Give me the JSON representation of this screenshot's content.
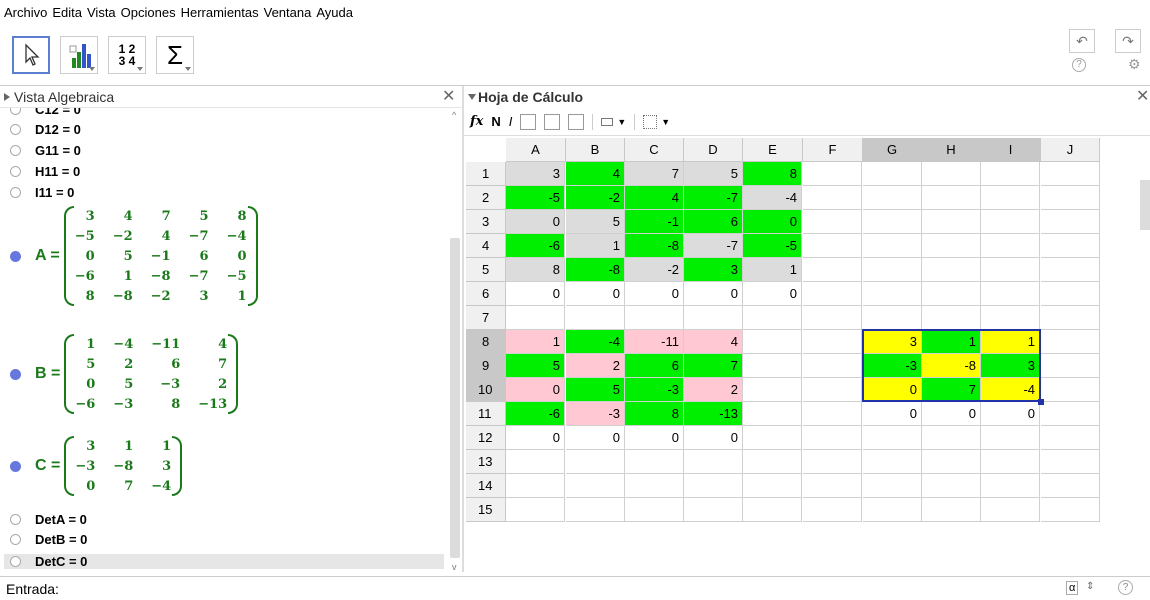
{
  "menu": [
    "Archivo",
    "Edita",
    "Vista",
    "Opciones",
    "Herramientas",
    "Ventana",
    "Ayuda"
  ],
  "toolbar": {
    "tools": [
      "move-tool",
      "chart-tool",
      "table-tool",
      "sum-tool"
    ],
    "table_tool_glyph": "1 2\n3 4",
    "sum_glyph": "Σ",
    "undo_glyph": "↶",
    "redo_glyph": "↷",
    "help_glyph": "?",
    "settings_glyph": "⚙"
  },
  "algebra_view": {
    "title": "Vista Algebraica",
    "items_top": [
      {
        "label": "C12 = 0",
        "filled": false
      },
      {
        "label": "D12 = 0",
        "filled": false
      },
      {
        "label": "G11 = 0",
        "filled": false
      },
      {
        "label": "H11 = 0",
        "filled": false
      },
      {
        "label": "I11 = 0",
        "filled": false
      }
    ],
    "matrices": [
      {
        "name": "A =",
        "rows": [
          [
            "3",
            "4",
            "7",
            "5",
            "8"
          ],
          [
            "−5",
            "−2",
            "4",
            "−7",
            "−4"
          ],
          [
            "0",
            "5",
            "−1",
            "6",
            "0"
          ],
          [
            "−6",
            "1",
            "−8",
            "−7",
            "−5"
          ],
          [
            "8",
            "−8",
            "−2",
            "3",
            "1"
          ]
        ]
      },
      {
        "name": "B =",
        "rows": [
          [
            "1",
            "−4",
            "−11",
            "4"
          ],
          [
            "5",
            "2",
            "6",
            "7"
          ],
          [
            "0",
            "5",
            "−3",
            "2"
          ],
          [
            "−6",
            "−3",
            "8",
            "−13"
          ]
        ]
      },
      {
        "name": "C =",
        "rows": [
          [
            "3",
            "1",
            "1"
          ],
          [
            "−3",
            "−8",
            "3"
          ],
          [
            "0",
            "7",
            "−4"
          ]
        ]
      }
    ],
    "items_bottom": [
      {
        "label": "DetA = 0",
        "filled": false
      },
      {
        "label": "DetB = 0",
        "filled": false
      },
      {
        "label": "DetC = 0",
        "filled": false
      }
    ]
  },
  "spreadsheet": {
    "title": "Hoja de Cálculo",
    "format_bar": {
      "fx": "fx",
      "bold": "N",
      "italic": "I"
    },
    "columns": [
      "A",
      "B",
      "C",
      "D",
      "E",
      "F",
      "G",
      "H",
      "I",
      "J"
    ],
    "highlight_cols": [
      "G",
      "H",
      "I"
    ],
    "rows": [
      "1",
      "2",
      "3",
      "4",
      "5",
      "6",
      "7",
      "8",
      "9",
      "10",
      "11",
      "12",
      "13",
      "14",
      "15"
    ],
    "highlight_rows": [
      "8",
      "9",
      "10"
    ],
    "cells": [
      {
        "r": 0,
        "c": 0,
        "v": "3",
        "bg": "#dcdcdc"
      },
      {
        "r": 0,
        "c": 1,
        "v": "4",
        "bg": "#00ee00"
      },
      {
        "r": 0,
        "c": 2,
        "v": "7",
        "bg": "#dcdcdc"
      },
      {
        "r": 0,
        "c": 3,
        "v": "5",
        "bg": "#dcdcdc"
      },
      {
        "r": 0,
        "c": 4,
        "v": "8",
        "bg": "#00ee00"
      },
      {
        "r": 1,
        "c": 0,
        "v": "-5",
        "bg": "#00ee00"
      },
      {
        "r": 1,
        "c": 1,
        "v": "-2",
        "bg": "#00ee00"
      },
      {
        "r": 1,
        "c": 2,
        "v": "4",
        "bg": "#00ee00"
      },
      {
        "r": 1,
        "c": 3,
        "v": "-7",
        "bg": "#00ee00"
      },
      {
        "r": 1,
        "c": 4,
        "v": "-4",
        "bg": "#dcdcdc"
      },
      {
        "r": 2,
        "c": 0,
        "v": "0",
        "bg": "#dcdcdc"
      },
      {
        "r": 2,
        "c": 1,
        "v": "5",
        "bg": "#dcdcdc"
      },
      {
        "r": 2,
        "c": 2,
        "v": "-1",
        "bg": "#00ee00"
      },
      {
        "r": 2,
        "c": 3,
        "v": "6",
        "bg": "#00ee00"
      },
      {
        "r": 2,
        "c": 4,
        "v": "0",
        "bg": "#00ee00"
      },
      {
        "r": 3,
        "c": 0,
        "v": "-6",
        "bg": "#00ee00"
      },
      {
        "r": 3,
        "c": 1,
        "v": "1",
        "bg": "#dcdcdc"
      },
      {
        "r": 3,
        "c": 2,
        "v": "-8",
        "bg": "#00ee00"
      },
      {
        "r": 3,
        "c": 3,
        "v": "-7",
        "bg": "#dcdcdc"
      },
      {
        "r": 3,
        "c": 4,
        "v": "-5",
        "bg": "#00ee00"
      },
      {
        "r": 4,
        "c": 0,
        "v": "8",
        "bg": "#dcdcdc"
      },
      {
        "r": 4,
        "c": 1,
        "v": "-8",
        "bg": "#00ee00"
      },
      {
        "r": 4,
        "c": 2,
        "v": "-2",
        "bg": "#dcdcdc"
      },
      {
        "r": 4,
        "c": 3,
        "v": "3",
        "bg": "#00ee00"
      },
      {
        "r": 4,
        "c": 4,
        "v": "1",
        "bg": "#dcdcdc"
      },
      {
        "r": 5,
        "c": 0,
        "v": "0",
        "bg": ""
      },
      {
        "r": 5,
        "c": 1,
        "v": "0",
        "bg": ""
      },
      {
        "r": 5,
        "c": 2,
        "v": "0",
        "bg": ""
      },
      {
        "r": 5,
        "c": 3,
        "v": "0",
        "bg": ""
      },
      {
        "r": 5,
        "c": 4,
        "v": "0",
        "bg": ""
      },
      {
        "r": 7,
        "c": 0,
        "v": "1",
        "bg": "#ffc8d2"
      },
      {
        "r": 7,
        "c": 1,
        "v": "-4",
        "bg": "#00ee00"
      },
      {
        "r": 7,
        "c": 2,
        "v": "-11",
        "bg": "#ffc8d2"
      },
      {
        "r": 7,
        "c": 3,
        "v": "4",
        "bg": "#ffc8d2"
      },
      {
        "r": 8,
        "c": 0,
        "v": "5",
        "bg": "#00ee00"
      },
      {
        "r": 8,
        "c": 1,
        "v": "2",
        "bg": "#ffc8d2"
      },
      {
        "r": 8,
        "c": 2,
        "v": "6",
        "bg": "#00ee00"
      },
      {
        "r": 8,
        "c": 3,
        "v": "7",
        "bg": "#00ee00"
      },
      {
        "r": 9,
        "c": 0,
        "v": "0",
        "bg": "#ffc8d2"
      },
      {
        "r": 9,
        "c": 1,
        "v": "5",
        "bg": "#00ee00"
      },
      {
        "r": 9,
        "c": 2,
        "v": "-3",
        "bg": "#00ee00"
      },
      {
        "r": 9,
        "c": 3,
        "v": "2",
        "bg": "#ffc8d2"
      },
      {
        "r": 10,
        "c": 0,
        "v": "-6",
        "bg": "#00ee00"
      },
      {
        "r": 10,
        "c": 1,
        "v": "-3",
        "bg": "#ffc8d2"
      },
      {
        "r": 10,
        "c": 2,
        "v": "8",
        "bg": "#00ee00"
      },
      {
        "r": 10,
        "c": 3,
        "v": "-13",
        "bg": "#00ee00"
      },
      {
        "r": 11,
        "c": 0,
        "v": "0",
        "bg": ""
      },
      {
        "r": 11,
        "c": 1,
        "v": "0",
        "bg": ""
      },
      {
        "r": 11,
        "c": 2,
        "v": "0",
        "bg": ""
      },
      {
        "r": 11,
        "c": 3,
        "v": "0",
        "bg": ""
      },
      {
        "r": 7,
        "c": 6,
        "v": "3",
        "bg": "#ffff00"
      },
      {
        "r": 7,
        "c": 7,
        "v": "1",
        "bg": "#00ee00"
      },
      {
        "r": 7,
        "c": 8,
        "v": "1",
        "bg": "#ffff00"
      },
      {
        "r": 8,
        "c": 6,
        "v": "-3",
        "bg": "#00ee00"
      },
      {
        "r": 8,
        "c": 7,
        "v": "-8",
        "bg": "#ffff00"
      },
      {
        "r": 8,
        "c": 8,
        "v": "3",
        "bg": "#00ee00"
      },
      {
        "r": 9,
        "c": 6,
        "v": "0",
        "bg": "#ffff00"
      },
      {
        "r": 9,
        "c": 7,
        "v": "7",
        "bg": "#00ee00"
      },
      {
        "r": 9,
        "c": 8,
        "v": "-4",
        "bg": "#ffff00"
      },
      {
        "r": 10,
        "c": 6,
        "v": "0",
        "bg": ""
      },
      {
        "r": 10,
        "c": 7,
        "v": "0",
        "bg": ""
      },
      {
        "r": 10,
        "c": 8,
        "v": "0",
        "bg": ""
      }
    ]
  },
  "input_bar": {
    "label": "Entrada:",
    "value": "",
    "alpha_glyph": "α",
    "help_glyph": "?"
  },
  "colors": {
    "matrix_green": "#1a7a1a",
    "selection": "#2233aa"
  }
}
